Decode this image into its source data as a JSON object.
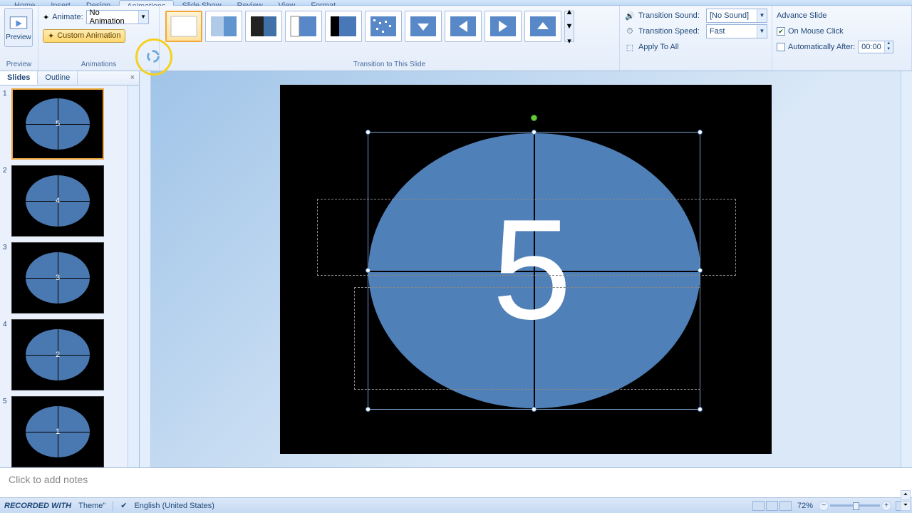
{
  "tabs": {
    "home": "Home",
    "insert": "Insert",
    "design": "Design",
    "animations": "Animations",
    "slideshow": "Slide Show",
    "review": "Review",
    "view": "View",
    "format": "Format"
  },
  "ribbon": {
    "preview": "Preview",
    "animations_label": "Animations",
    "animate_label": "Animate:",
    "animate_value": "No Animation",
    "custom_anim": "Custom Animation",
    "transition_label": "Transition to This Slide",
    "sound_label": "Transition Sound:",
    "sound_value": "[No Sound]",
    "speed_label": "Transition Speed:",
    "speed_value": "Fast",
    "apply_all": "Apply To All",
    "advance_label": "Advance Slide",
    "on_click": "On Mouse Click",
    "auto_after": "Automatically After:",
    "auto_value": "00:00"
  },
  "pane": {
    "slides": "Slides",
    "outline": "Outline"
  },
  "slides": [
    {
      "num": "1",
      "value": "5",
      "selected": true
    },
    {
      "num": "2",
      "value": "4",
      "selected": false
    },
    {
      "num": "3",
      "value": "3",
      "selected": false
    },
    {
      "num": "4",
      "value": "2",
      "selected": false
    },
    {
      "num": "5",
      "value": "1",
      "selected": false
    }
  ],
  "current_slide_value": "5",
  "notes_placeholder": "Click to add notes",
  "status": {
    "recorded": "RECORDED WITH",
    "theme": "Theme\"",
    "lang": "English (United States)",
    "zoom": "72%"
  }
}
